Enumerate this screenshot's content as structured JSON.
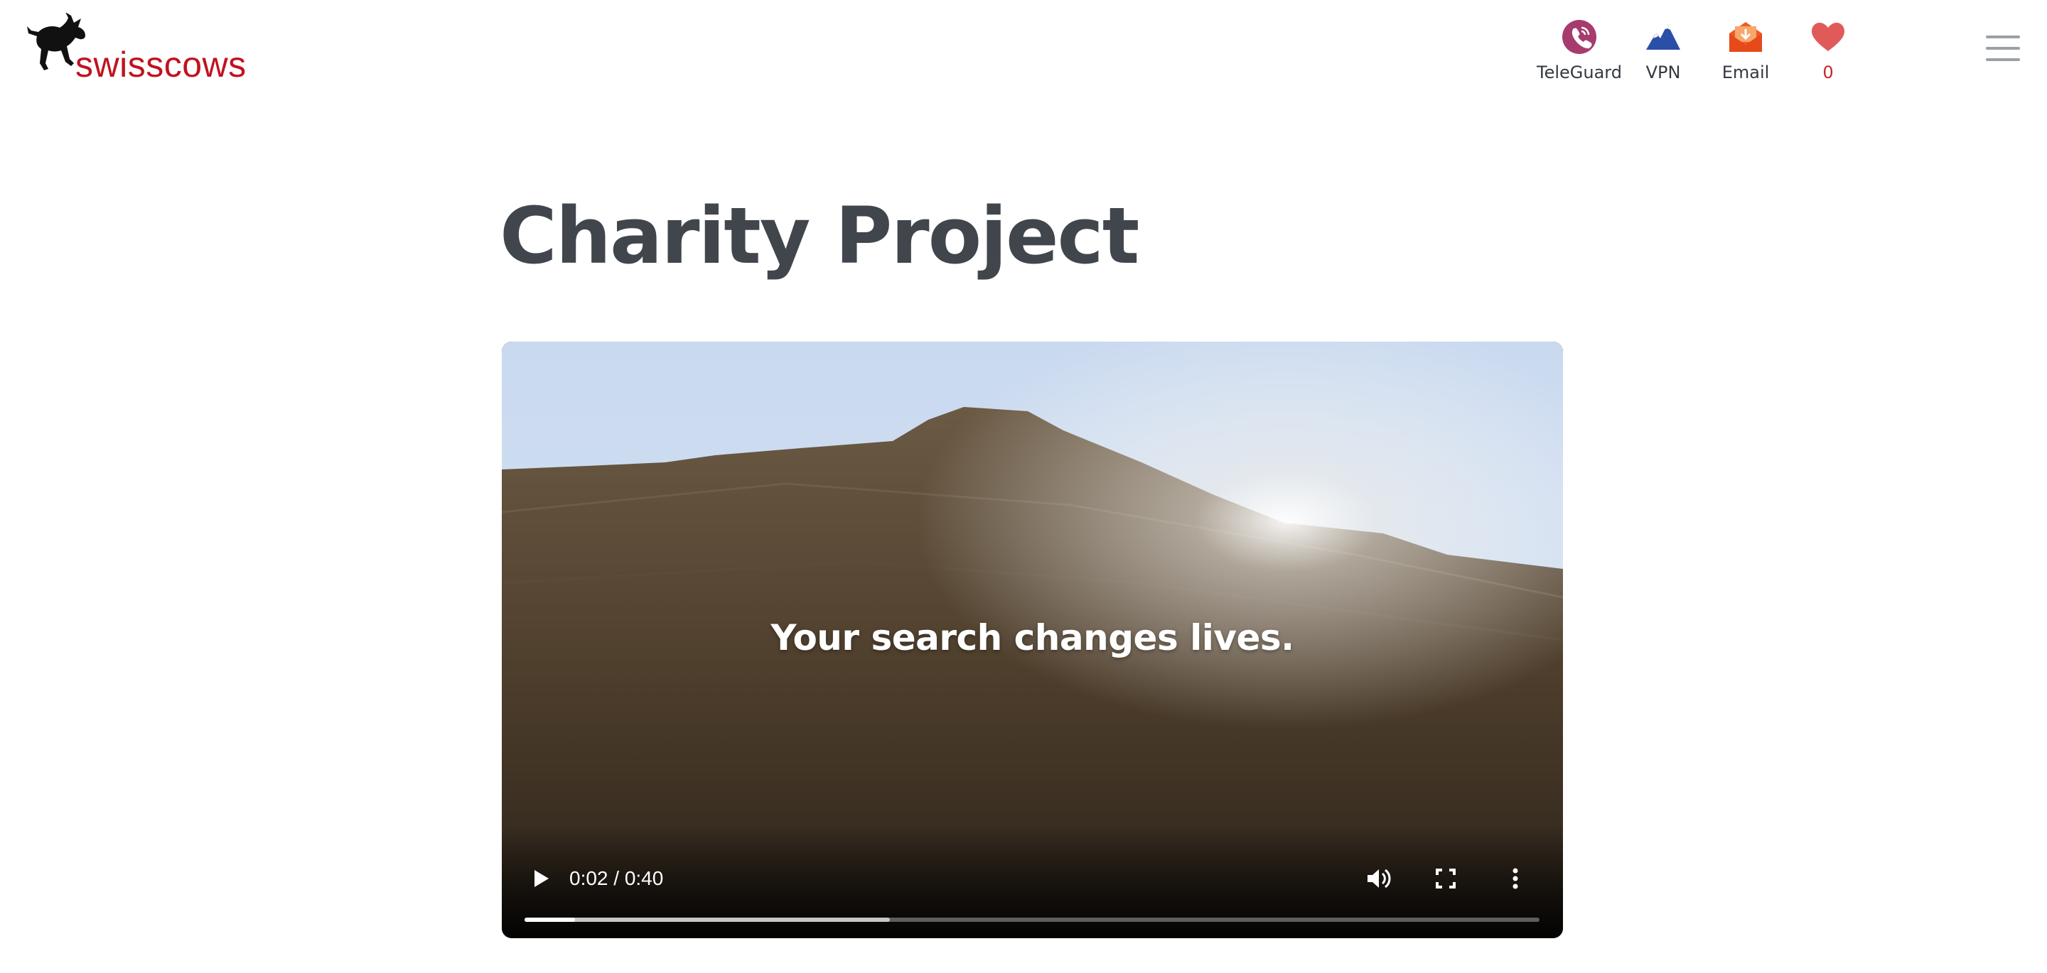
{
  "header": {
    "brand": "swisscows",
    "nav": [
      {
        "label": "TeleGuard",
        "icon": "teleguard-icon"
      },
      {
        "label": "VPN",
        "icon": "vpn-mountain-icon"
      },
      {
        "label": "Email",
        "icon": "email-envelope-icon"
      },
      {
        "label": "0",
        "icon": "heart-icon"
      }
    ],
    "menu_icon": "hamburger-menu-icon"
  },
  "page": {
    "title": "Charity Project"
  },
  "video": {
    "caption": "Your search changes lives.",
    "time": "0:02 / 0:40",
    "played_fraction": 0.05,
    "buffered_fraction": 0.36
  },
  "colors": {
    "brand_red": "#c1121f",
    "title_gray": "#41464c",
    "teleguard_purple": "#a63b6e",
    "vpn_blue": "#2a4fa6",
    "email_orange": "#f05a28",
    "heart_red": "#e05a5a"
  }
}
